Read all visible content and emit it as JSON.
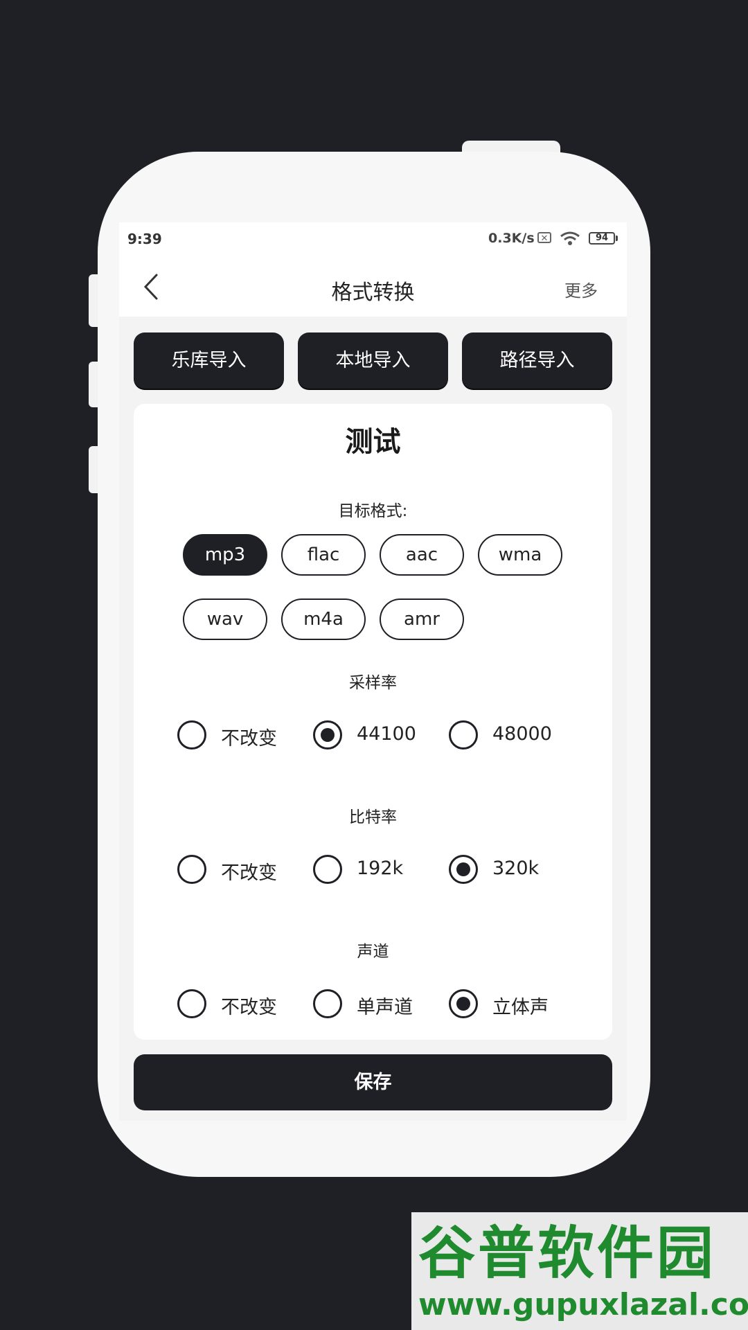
{
  "status_bar": {
    "time": "9:39",
    "network_speed": "0.3K/s",
    "sim_icon": "sim-off-icon",
    "wifi_icon": "wifi-icon",
    "battery": "94"
  },
  "nav": {
    "back_icon": "chevron-left-icon",
    "title": "格式转换",
    "more": "更多"
  },
  "import_buttons": [
    "乐库导入",
    "本地导入",
    "路径导入"
  ],
  "card": {
    "title": "测试",
    "format": {
      "label": "目标格式:",
      "options": [
        "mp3",
        "flac",
        "aac",
        "wma",
        "wav",
        "m4a",
        "amr"
      ],
      "selected": "mp3"
    },
    "sample_rate": {
      "label": "采样率",
      "options": [
        "不改变",
        "44100",
        "48000"
      ],
      "selected": "44100"
    },
    "bit_rate": {
      "label": "比特率",
      "options": [
        "不改变",
        "192k",
        "320k"
      ],
      "selected": "320k"
    },
    "channel": {
      "label": "声道",
      "options": [
        "不改变",
        "单声道",
        "立体声"
      ],
      "selected": "立体声"
    }
  },
  "save_label": "保存",
  "watermark": {
    "logo_text": "谷普软件园",
    "url": "www.gupuxlazal.com"
  },
  "colors": {
    "background": "#1f1f26",
    "accent": "#1f1f26",
    "card": "#ffffff",
    "watermark_green": "#1f8a2e"
  }
}
